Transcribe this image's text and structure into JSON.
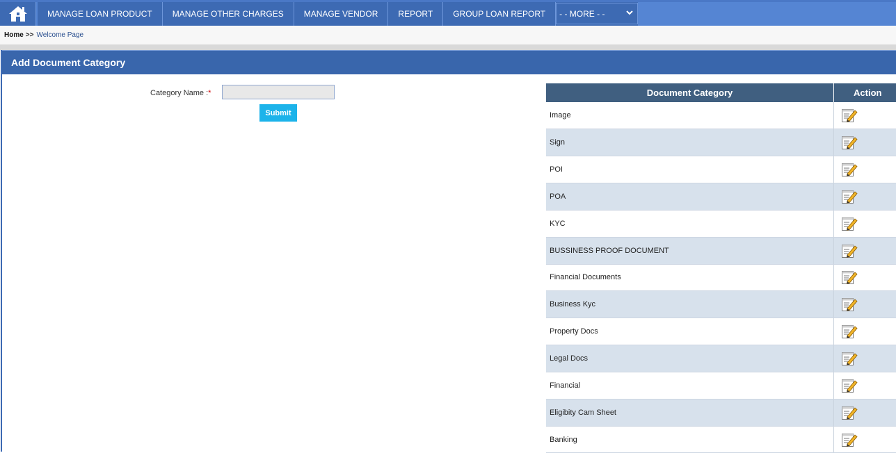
{
  "nav": {
    "home_icon": "home-icon",
    "items": [
      "MANAGE LOAN PRODUCT",
      "MANAGE OTHER CHARGES",
      "MANAGE VENDOR",
      "REPORT",
      "GROUP LOAN REPORT"
    ],
    "more_select": "- - MORE - -"
  },
  "breadcrumb": {
    "home": "Home",
    "separator": ">>",
    "current": "Welcome Page"
  },
  "panel": {
    "title": "Add Document Category"
  },
  "form": {
    "category_label": "Category Name :",
    "required_mark": "*",
    "category_value": "",
    "submit_label": "Submit"
  },
  "table": {
    "headers": [
      "Document Category",
      "Action"
    ],
    "rows": [
      {
        "name": "Image",
        "action_icon": "edit-icon"
      },
      {
        "name": "Sign",
        "action_icon": "edit-icon"
      },
      {
        "name": "POI",
        "action_icon": "edit-icon"
      },
      {
        "name": "POA",
        "action_icon": "edit-icon"
      },
      {
        "name": "KYC",
        "action_icon": "edit-icon"
      },
      {
        "name": "BUSSINESS PROOF DOCUMENT",
        "action_icon": "edit-icon"
      },
      {
        "name": "Financial Documents",
        "action_icon": "edit-icon"
      },
      {
        "name": "Business Kyc",
        "action_icon": "edit-icon"
      },
      {
        "name": "Property Docs",
        "action_icon": "edit-icon"
      },
      {
        "name": "Legal Docs",
        "action_icon": "edit-icon"
      },
      {
        "name": "Financial",
        "action_icon": "edit-icon"
      },
      {
        "name": "Eligibity Cam Sheet",
        "action_icon": "edit-icon"
      },
      {
        "name": "Banking",
        "action_icon": "edit-icon"
      }
    ]
  },
  "colors": {
    "nav_bg": "#5585d3",
    "nav_item_bg": "#3d6ab3",
    "panel_header": "#3966ac",
    "table_header": "#405f80",
    "row_alt": "#d7e1ec",
    "submit": "#1cb3ea"
  }
}
